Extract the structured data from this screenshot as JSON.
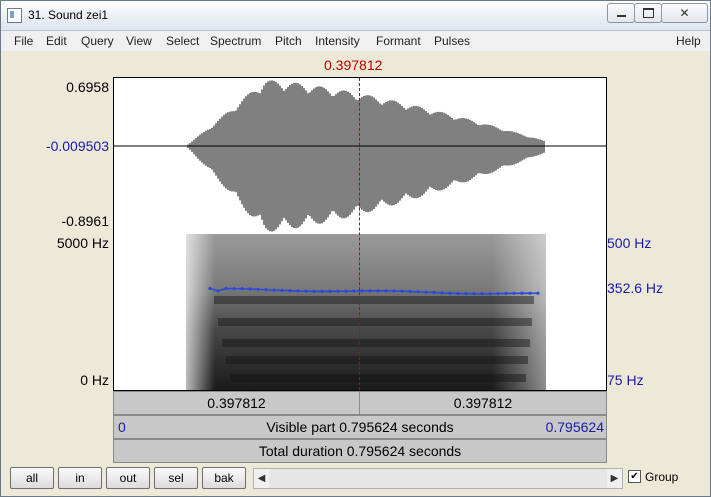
{
  "window": {
    "title": "31. Sound zei1",
    "minimize_icon": "minimize-icon",
    "maximize_icon": "maximize-icon",
    "close_glyph": "✕"
  },
  "menu": {
    "items": [
      "File",
      "Edit",
      "Query",
      "View",
      "Select",
      "Spectrum",
      "Pitch",
      "Intensity",
      "Formant",
      "Pulses"
    ],
    "help": "Help"
  },
  "cursor": {
    "time": "0.397812"
  },
  "waveform": {
    "y_max": "0.6958",
    "y_mid": "-0.009503",
    "y_min": "-0.8961"
  },
  "spectrogram": {
    "freq_top": "5000 Hz",
    "freq_bottom": "0 Hz",
    "pitch_top": "500 Hz",
    "pitch_value": "352.6 Hz",
    "pitch_bottom": "75 Hz"
  },
  "bars": {
    "left_time": "0.397812",
    "right_time": "0.397812",
    "visible_start": "0",
    "visible_text": "Visible part 0.795624 seconds",
    "visible_end": "0.795624",
    "total_text": "Total duration 0.795624 seconds"
  },
  "buttons": [
    "all",
    "in",
    "out",
    "sel",
    "bak"
  ],
  "group": {
    "label": "Group",
    "checked": true,
    "check_glyph": "✔"
  },
  "colors": {
    "cursor": "#c00000",
    "pitch": "#1a1aa8",
    "pitch_line": "#2a4ad8"
  }
}
